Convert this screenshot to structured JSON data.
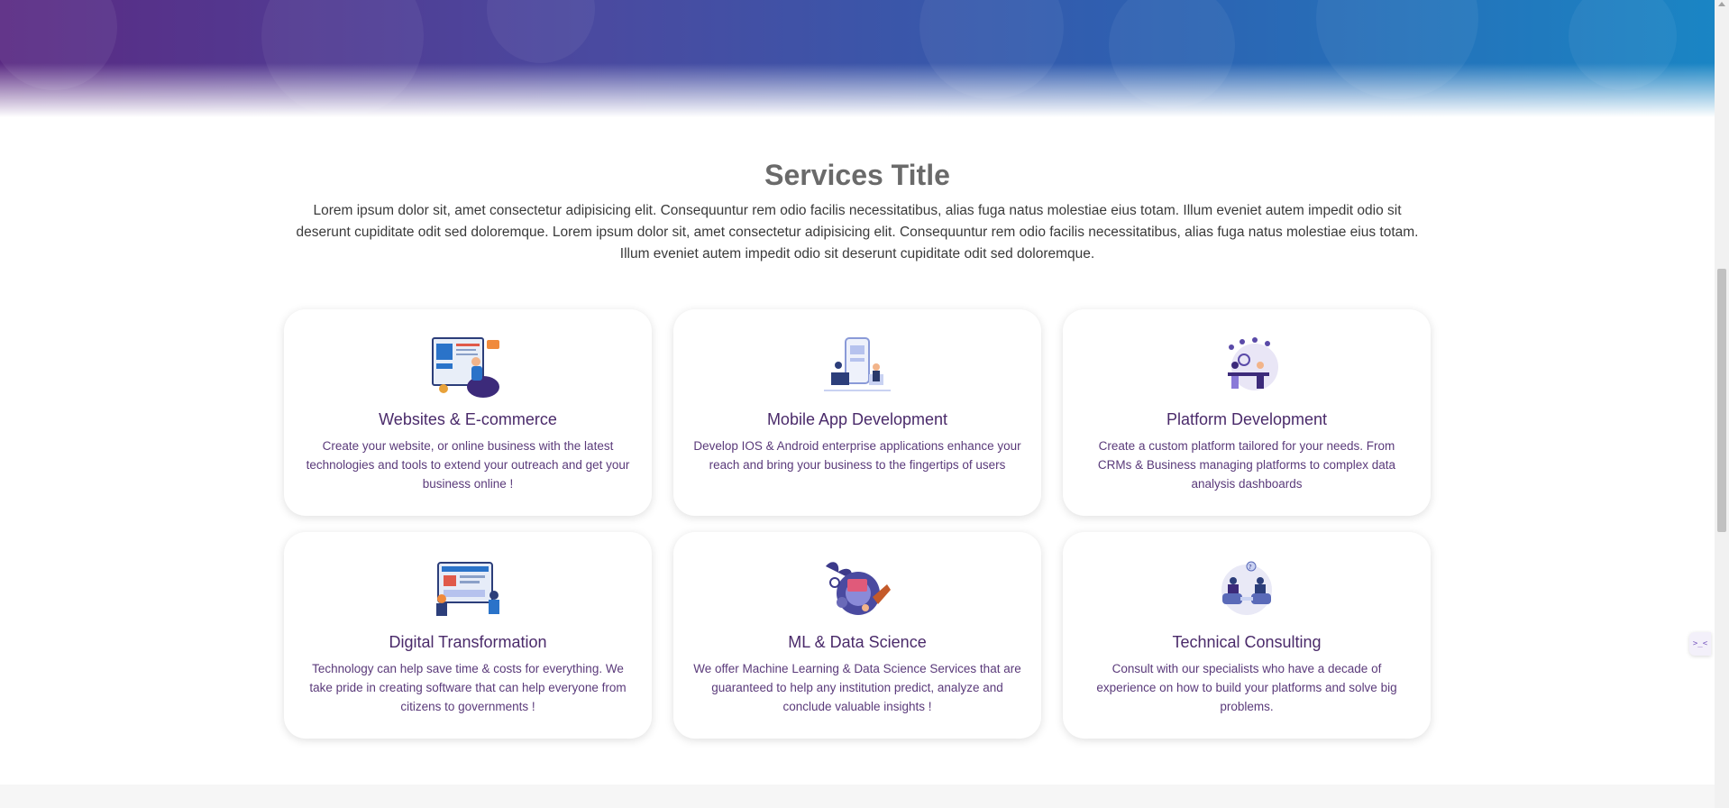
{
  "hero": {
    "background_colors": [
      "#5a2a83",
      "#2f5fb0",
      "#1a85c4"
    ]
  },
  "services": {
    "title": "Services Title",
    "intro": "Lorem ipsum dolor sit, amet consectetur adipisicing elit. Consequuntur rem odio facilis necessitatibus, alias fuga natus molestiae eius totam. Illum eveniet autem impedit odio sit deserunt cupiditate odit sed doloremque. Lorem ipsum dolor sit, amet consectetur adipisicing elit. Consequuntur rem odio facilis necessitatibus, alias fuga natus molestiae eius totam. Illum eveniet autem impedit odio sit deserunt cupiditate odit sed doloremque.",
    "cards": [
      {
        "title": "Websites & E-commerce",
        "description": "Create your website, or online business with the latest technologies and tools to extend your outreach and get your business online !",
        "icon": "website-illustration-icon"
      },
      {
        "title": "Mobile App Development",
        "description": "Develop IOS & Android enterprise applications enhance your reach and bring your business to the fingertips of users",
        "icon": "mobile-app-illustration-icon"
      },
      {
        "title": "Platform Development",
        "description": "Create a custom platform tailored for your needs. From CRMs & Business managing platforms to complex data analysis dashboards",
        "icon": "platform-illustration-icon"
      },
      {
        "title": "Digital Transformation",
        "description": "Technology can help save time & costs for everything. We take pride in creating software that can help everyone from citizens to governments !",
        "icon": "digital-transformation-illustration-icon"
      },
      {
        "title": "ML & Data Science",
        "description": "We offer Machine Learning & Data Science Services that are guaranteed to help any institution predict, analyze and conclude valuable insights !",
        "icon": "ml-data-science-illustration-icon"
      },
      {
        "title": "Technical Consulting",
        "description": "Consult with our specialists who have a decade of experience on how to build your platforms and solve big problems.",
        "icon": "consulting-illustration-icon"
      }
    ]
  },
  "side_widget": {
    "label": ">_<"
  },
  "colors": {
    "card_title": "#4a2a6a",
    "card_text": "#5a3a7a",
    "section_title": "#6a6a6a"
  }
}
